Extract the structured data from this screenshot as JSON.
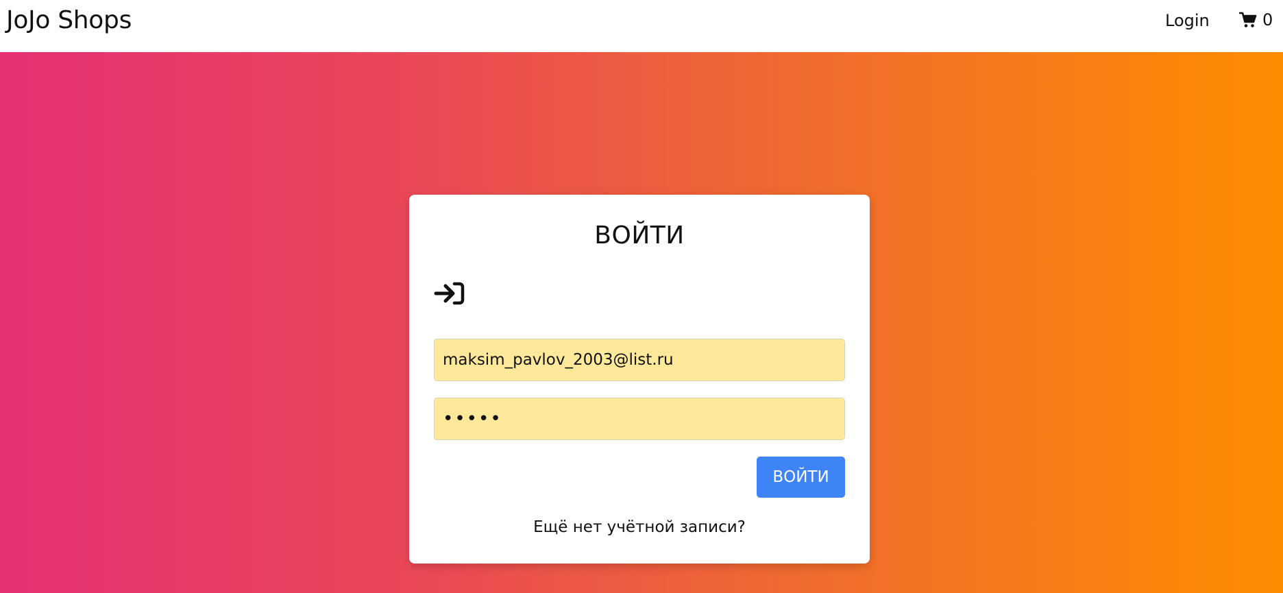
{
  "navbar": {
    "brand": "JoJo Shops",
    "login_label": "Login",
    "cart_icon": "shopping-cart-icon",
    "cart_count": "0"
  },
  "login_card": {
    "title": "ВОЙТИ",
    "icon": "sign-in-arrow-icon",
    "email_value": "maksim_pavlov_2003@list.ru",
    "password_value": "•••••",
    "submit_label": "ВОЙТИ",
    "register_link": "Ещё нет учётной записи?"
  },
  "colors": {
    "gradient_start": "#e63174",
    "gradient_end": "#ff8c00",
    "button": "#3f84f6",
    "autofill_background": "#fde999"
  }
}
